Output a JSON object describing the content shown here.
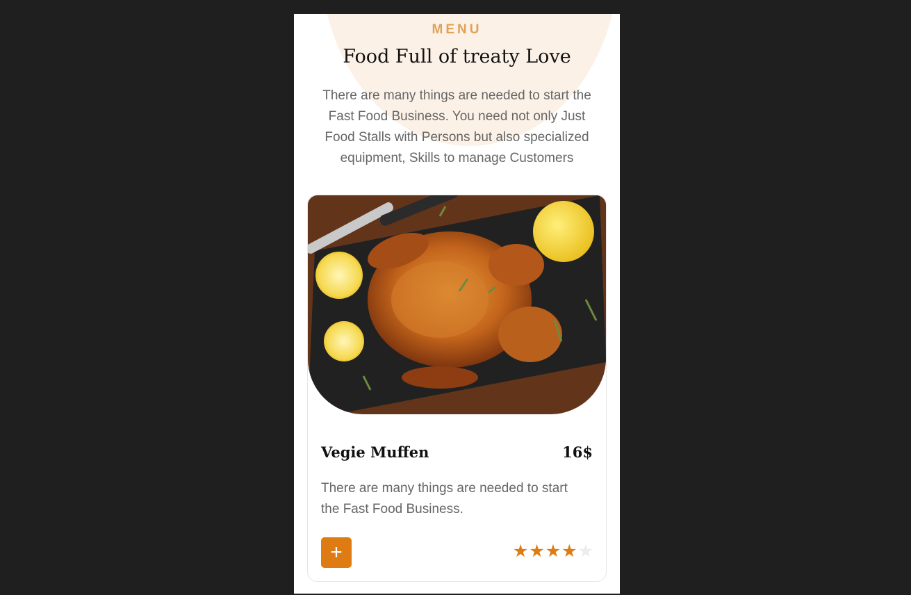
{
  "menu": {
    "eyebrow": "MENU",
    "title": "Food Full of treaty Love",
    "intro": "There are many things are needed to start the Fast Food Business. You need not only Just Food Stalls with Persons but also specialized equipment, Skills to manage Customers"
  },
  "card": {
    "image_subject": "roast chicken on slate board with lemons and thyme",
    "name": "Vegie Muffen",
    "price": "16$",
    "description": "There are many things are needed to start the Fast Food Business.",
    "add_label": "+",
    "rating": 4,
    "rating_max": 5,
    "star_glyph": "★"
  },
  "colors": {
    "accent": "#de7b12",
    "eyebrow": "#e0a157",
    "blob": "#fcf1e7",
    "background": "#1f1f20"
  }
}
